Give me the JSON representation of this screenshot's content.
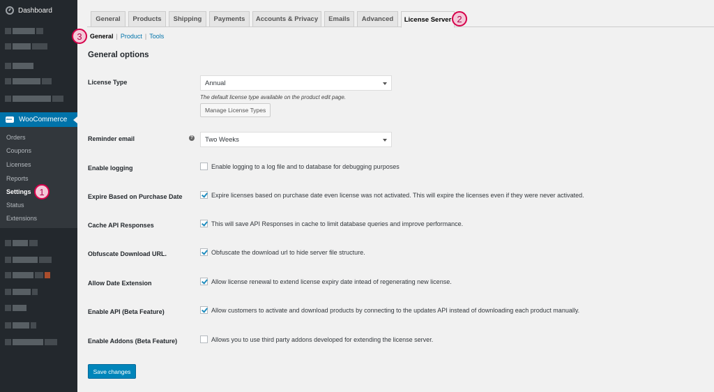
{
  "sidebar": {
    "dashboard": "Dashboard",
    "woocommerce": "WooCommerce",
    "submenu": [
      "Orders",
      "Coupons",
      "Licenses",
      "Reports",
      "Settings",
      "Status",
      "Extensions"
    ],
    "active_item": "Settings",
    "icons": {
      "dashboard": "dashboard-gauge-icon",
      "woocommerce": "woo-logo-icon"
    }
  },
  "annotations": [
    "1",
    "2",
    "3"
  ],
  "tabs": [
    "General",
    "Products",
    "Shipping",
    "Payments",
    "Accounts & Privacy",
    "Emails",
    "Advanced",
    "License Server"
  ],
  "active_tab": "License Server",
  "subnav": {
    "current": "General",
    "links": [
      "Product",
      "Tools"
    ],
    "separator": "|"
  },
  "section_title": "General options",
  "license_type": {
    "label": "License Type",
    "value": "Annual",
    "description": "The default license type available on the product edit page.",
    "button": "Manage License Types"
  },
  "reminder_email": {
    "label": "Reminder email",
    "value": "Two Weeks",
    "help_icon": "?"
  },
  "options": [
    {
      "label": "Enable logging",
      "text": "Enable logging to a log file and to database for debugging purposes",
      "checked": false
    },
    {
      "label": "Expire Based on Purchase Date",
      "text": "Expire licenses based on purchase date even license was not activated. This will expire the licenses even if they were never activated.",
      "checked": true
    },
    {
      "label": "Cache API Responses",
      "text": "This will save API Responses in cache to limit database queries and improve performance.",
      "checked": true
    },
    {
      "label": "Obfuscate Download URL.",
      "text": "Obfuscate the download url to hide server file structure.",
      "checked": true
    },
    {
      "label": "Allow Date Extension",
      "text": "Allow license renewal to extend license expiry date intead of regenerating new license.",
      "checked": true
    },
    {
      "label": "Enable API (Beta Feature)",
      "text": "Allow customers to activate and download products by connecting to the updates API instead of downloading each product manually.",
      "checked": true
    },
    {
      "label": "Enable Addons (Beta Feature)",
      "text": "Allows you to use third party addons developed for extending the license server.",
      "checked": false
    }
  ],
  "save_button": "Save changes",
  "colors": {
    "sidebar": "#23282d",
    "accent": "#0073aa",
    "primary_button": "#0085ba",
    "annotation": "#d6004a"
  }
}
